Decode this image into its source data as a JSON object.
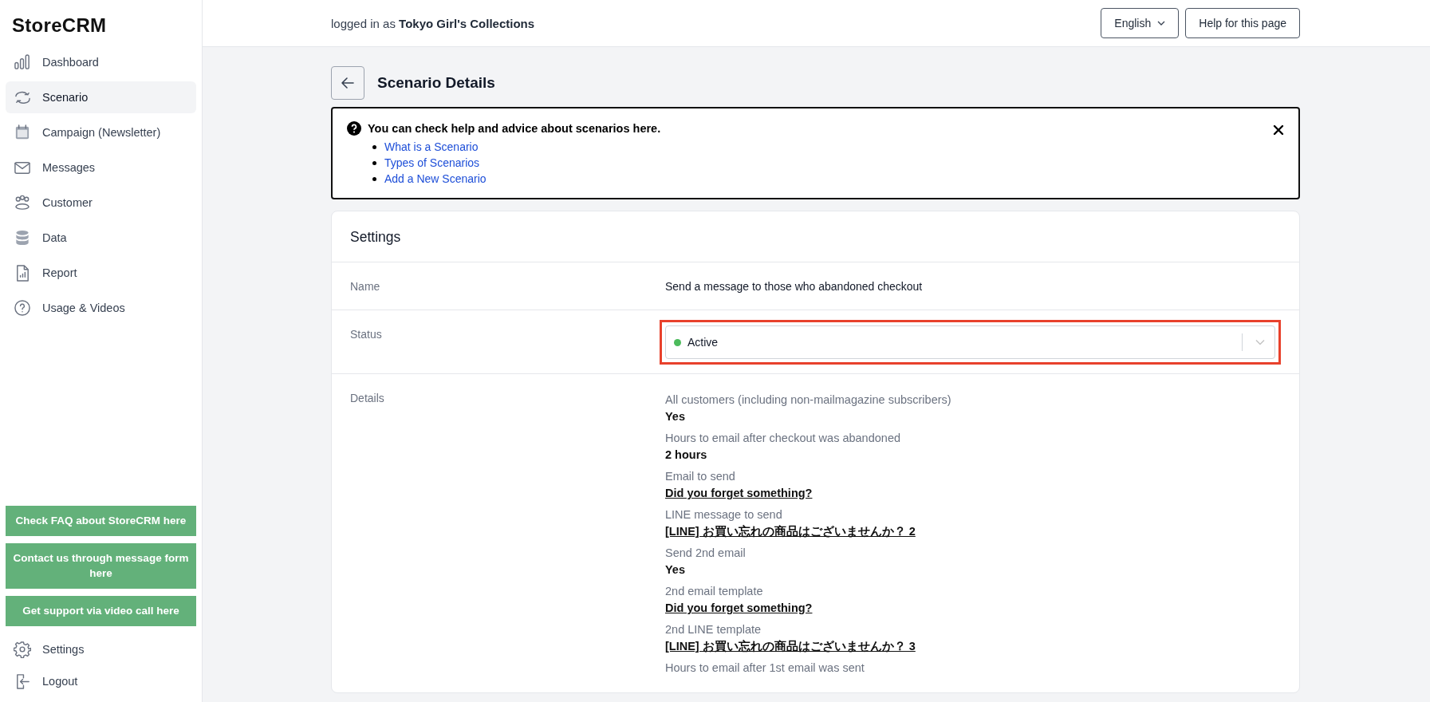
{
  "sidebar": {
    "logo": "StoreCRM",
    "items": [
      {
        "label": "Dashboard",
        "selected": false
      },
      {
        "label": "Scenario",
        "selected": true
      },
      {
        "label": "Campaign (Newsletter)",
        "selected": false
      },
      {
        "label": "Messages",
        "selected": false
      },
      {
        "label": "Customer",
        "selected": false
      },
      {
        "label": "Data",
        "selected": false
      },
      {
        "label": "Report",
        "selected": false
      },
      {
        "label": "Usage & Videos",
        "selected": false
      }
    ],
    "support_buttons": [
      "Check FAQ about StoreCRM here",
      "Contact us through message form here",
      "Get support via video call here"
    ],
    "footer_items": [
      {
        "label": "Settings"
      },
      {
        "label": "Logout"
      }
    ]
  },
  "header": {
    "login_prefix": "logged in as",
    "store_name": "Tokyo Girl's Collections",
    "language": "English",
    "help_button": "Help for this page"
  },
  "page": {
    "title": "Scenario Details"
  },
  "help_box": {
    "title": "You can check help and advice about scenarios here.",
    "links": [
      "What is a Scenario",
      "Types of Scenarios",
      "Add a New Scenario"
    ]
  },
  "settings": {
    "title": "Settings",
    "name": {
      "label": "Name",
      "value": "Send a message to those who abandoned checkout"
    },
    "status": {
      "label": "Status",
      "value": "Active",
      "color": "#4cbb5c",
      "highlighted": true
    },
    "details": {
      "label": "Details",
      "items": [
        {
          "label": "All customers (including non-mailmagazine subscribers)",
          "value": "Yes",
          "kind": "text"
        },
        {
          "label": "Hours to email after checkout was abandoned",
          "value": "2 hours",
          "kind": "text"
        },
        {
          "label": "Email to send",
          "value": "Did you forget something?",
          "kind": "link"
        },
        {
          "label": "LINE message to send",
          "value": "[LINE] お買い忘れの商品はございませんか？ 2",
          "kind": "link"
        },
        {
          "label": "Send 2nd email",
          "value": "Yes",
          "kind": "text"
        },
        {
          "label": "2nd email template",
          "value": "Did you forget something?",
          "kind": "link"
        },
        {
          "label": "2nd LINE template",
          "value": "[LINE] お買い忘れの商品はございませんか？ 3",
          "kind": "link"
        },
        {
          "label": "Hours to email after 1st email was sent"
        }
      ]
    }
  }
}
